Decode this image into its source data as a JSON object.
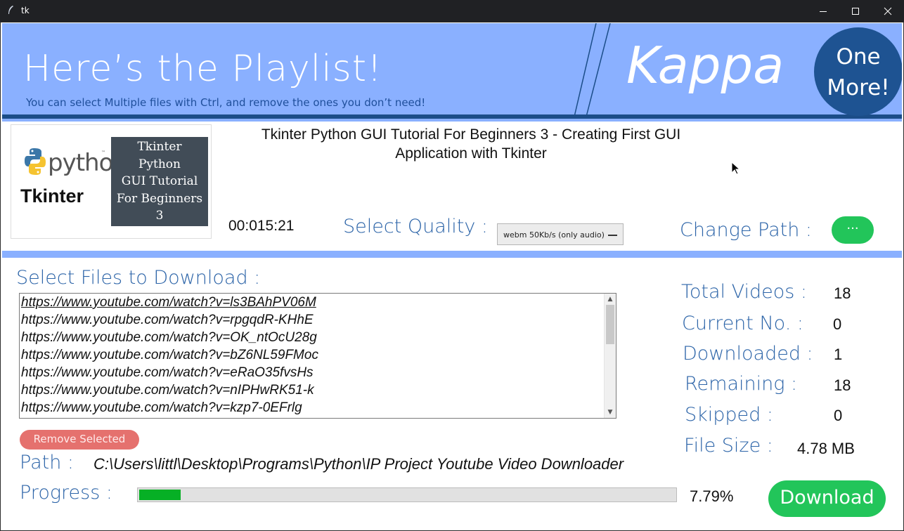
{
  "window": {
    "title": "tk"
  },
  "banner": {
    "title": "Here’s the Playlist!",
    "subtitle": "You can select Multiple files with Ctrl, and remove the ones you don’t need!",
    "brand": "Kappa",
    "one_more_line1": "One",
    "one_more_line2": "More!"
  },
  "thumbnail": {
    "python_word": "python",
    "tm": "™",
    "tkinter_word": "Tkinter",
    "box_lines": [
      "Tkinter",
      "Python",
      "GUI Tutorial",
      "For Beginners",
      "3"
    ]
  },
  "video": {
    "title_line1": "Tkinter Python GUI Tutorial For Beginners 3 - Creating First GUI",
    "title_line2": "Application with Tkinter",
    "duration": "00:015:21"
  },
  "quality": {
    "label": "Select Quality :",
    "selected": "webm 50Kb/s (only audio)"
  },
  "change_path": {
    "label": "Change Path :",
    "button": "···"
  },
  "files": {
    "label": "Select Files to Download :",
    "items": [
      "https://www.youtube.com/watch?v=ls3BAhPV06M",
      "https://www.youtube.com/watch?v=rpgqdR-KHhE",
      "https://www.youtube.com/watch?v=OK_ntOcU28g",
      "https://www.youtube.com/watch?v=bZ6NL59FMoc",
      "https://www.youtube.com/watch?v=eRaO35fvsHs",
      "https://www.youtube.com/watch?v=nIPHwRK51-k",
      "https://www.youtube.com/watch?v=kzp7-0EFrlg"
    ],
    "remove_button": "Remove Selected"
  },
  "path": {
    "label": "Path :",
    "value": "C:\\Users\\littl\\Desktop\\Programs\\Python\\IP Project Youtube Video Downloader"
  },
  "progress": {
    "label": "Progress :",
    "percent_text": "7.79%",
    "fraction": 0.0779
  },
  "download_button": "Download",
  "stats": {
    "total_label": "Total Videos :",
    "total_value": "18",
    "current_label": "Current No. :",
    "current_value": "0",
    "downloaded_label": "Downloaded :",
    "downloaded_value": "1",
    "remaining_label": "Remaining :",
    "remaining_value": "18",
    "skipped_label": "Skipped :",
    "skipped_value": "0",
    "size_label": "File Size :",
    "size_value": "4.78 MB"
  },
  "colors": {
    "banner_bg": "#8ab0ff",
    "banner_stripe": "#1b4d88",
    "circle": "#1e5392",
    "label_blue": "#2c64a8",
    "green_button": "#22c55a",
    "remove_button": "#e5716e",
    "progress_fill": "#06b025"
  }
}
